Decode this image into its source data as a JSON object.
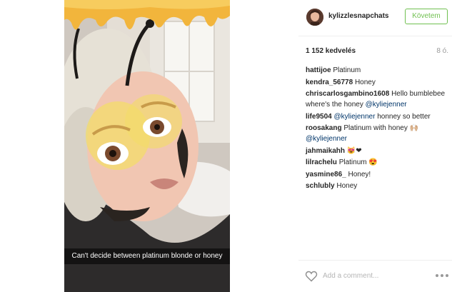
{
  "post": {
    "caption_overlay": "Can't decide between platinum blonde or honey",
    "image_icon": "bee-filter-selfie"
  },
  "header": {
    "username": "kylizzlesnapchats",
    "follow_label": "Követem"
  },
  "stats": {
    "likes": "1 152 kedvelés",
    "age": "8 ó."
  },
  "comments": [
    {
      "user": "hattijoe",
      "parts": [
        {
          "t": "text",
          "v": "Platinum"
        }
      ]
    },
    {
      "user": "kendra_56778",
      "parts": [
        {
          "t": "text",
          "v": "Honey"
        }
      ]
    },
    {
      "user": "chriscarlosgambino1608",
      "parts": [
        {
          "t": "text",
          "v": "Hello bumblebee where's the honey "
        },
        {
          "t": "mention",
          "v": "@kyliejenner"
        }
      ]
    },
    {
      "user": "life9504",
      "parts": [
        {
          "t": "mention",
          "v": "@kyliejenner"
        },
        {
          "t": "text",
          "v": " honney so better"
        }
      ]
    },
    {
      "user": "roosakang",
      "parts": [
        {
          "t": "text",
          "v": "Platinum with honey 🙌🏼 "
        },
        {
          "t": "mention",
          "v": "@kyliejenner"
        }
      ]
    },
    {
      "user": "jahmaikahh",
      "parts": [
        {
          "t": "text",
          "v": "😻❤"
        }
      ]
    },
    {
      "user": "lilrachelu",
      "parts": [
        {
          "t": "text",
          "v": "Platinum 😍"
        }
      ]
    },
    {
      "user": "yasmine86_",
      "parts": [
        {
          "t": "text",
          "v": "Honey!"
        }
      ]
    },
    {
      "user": "schlubly",
      "parts": [
        {
          "t": "text",
          "v": "Honey"
        }
      ]
    }
  ],
  "add_comment": {
    "placeholder": "Add a comment...",
    "like_icon": "heart-outline-icon",
    "more_icon": "more-options-icon"
  },
  "colors": {
    "follow_green": "#70c050",
    "mention_blue": "#003569",
    "muted_gray": "#999999"
  }
}
